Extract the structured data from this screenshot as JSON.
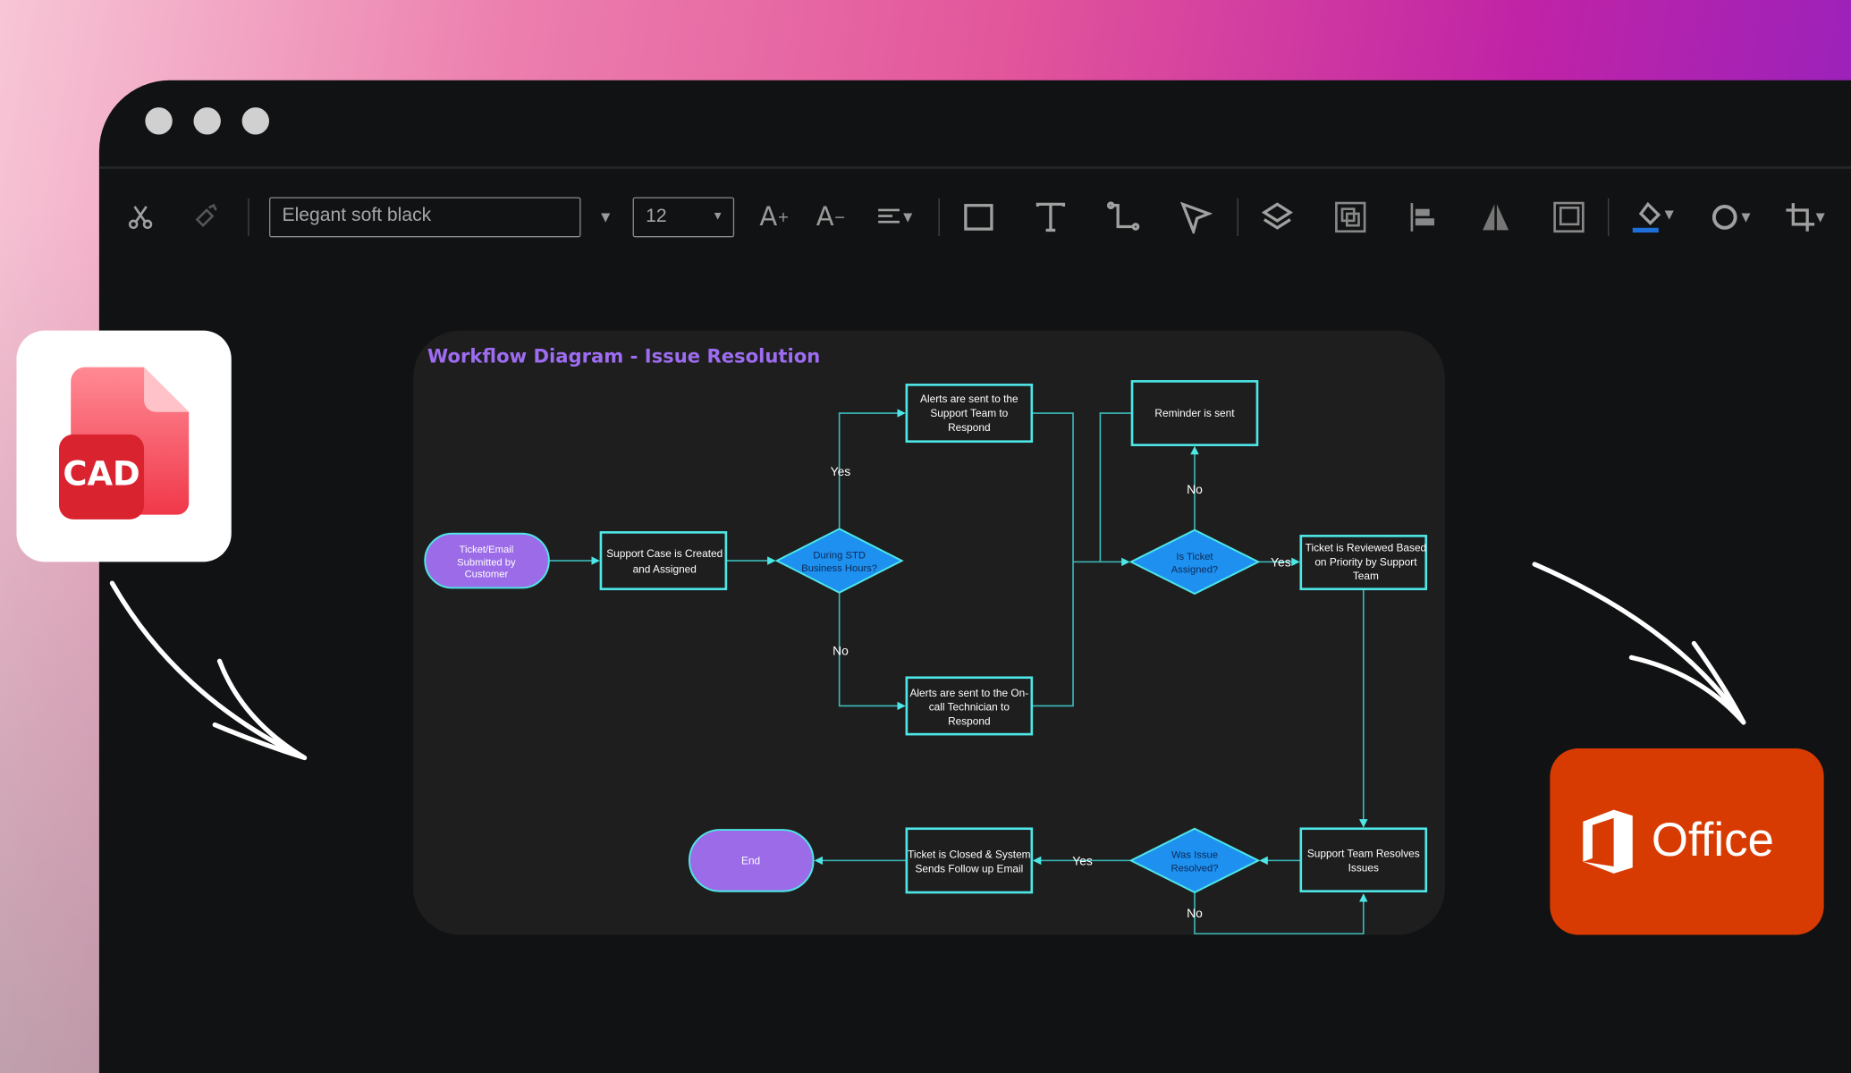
{
  "toolbar": {
    "font_name": "Elegant soft black",
    "font_size": "12",
    "icons": [
      "scissors-icon",
      "format-painter-icon",
      "increase-font-icon",
      "decrease-font-icon",
      "align-icon",
      "rectangle-icon",
      "text-icon",
      "connector-icon",
      "pen-icon",
      "layers-icon",
      "group-icon",
      "align-left-icon",
      "flip-icon",
      "frame-icon",
      "fill-color-icon",
      "shape-icon",
      "crop-icon"
    ],
    "fill_accent": "#1e6fd9"
  },
  "diagram": {
    "title": "Workflow Diagram - Issue Resolution",
    "nodes": {
      "start": [
        "Ticket/Email",
        "Submitted by",
        "Customer"
      ],
      "case": [
        "Support Case is Created",
        "and Assigned"
      ],
      "d1": [
        "During STD",
        "Business Hours?"
      ],
      "alert_team": [
        "Alerts are sent to the",
        "Support Team to",
        "Respond"
      ],
      "alert_tech": [
        "Alerts are sent to the On-",
        "call Technician to",
        "Respond"
      ],
      "reminder": [
        "Reminder is sent"
      ],
      "d2": [
        "Is Ticket",
        "Assigned?"
      ],
      "reviewed": [
        "Ticket is Reviewed Based",
        "on Priority by Support",
        "Team"
      ],
      "resolves": [
        "Support Team Resolves",
        "Issues"
      ],
      "d3": [
        "Was Issue",
        "Resolved?"
      ],
      "closed": [
        "Ticket is Closed & System",
        "Sends Follow up Email"
      ],
      "end": [
        "End"
      ]
    },
    "labels": {
      "yes1": "Yes",
      "no1": "No",
      "no2": "No",
      "yes2": "Yes",
      "yes3": "Yes",
      "no3": "No"
    },
    "colors": {
      "line": "#3cc7c7",
      "border": "#4ee6e6",
      "terminal": "#9b6be8",
      "decision": "#1e90f0"
    }
  },
  "badges": {
    "cad": "CAD",
    "office": "Office"
  }
}
